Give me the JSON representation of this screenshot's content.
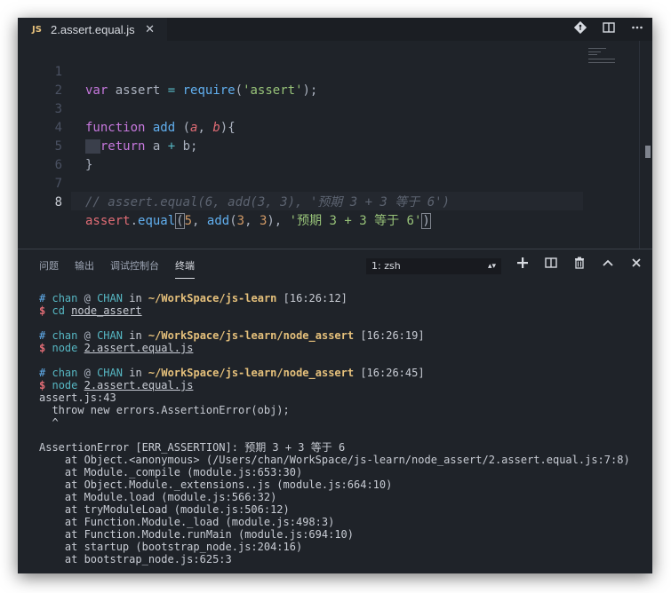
{
  "tab": {
    "icon": "JS",
    "filename": "2.assert.equal.js",
    "close": "✕"
  },
  "editor_actions": [
    "git-compare-icon",
    "split-editor-icon",
    "more-icon"
  ],
  "code_lines": [
    {
      "num": "1",
      "text": "var assert = require('assert');"
    },
    {
      "num": "2",
      "text": ""
    },
    {
      "num": "3",
      "text": "function add (a, b){"
    },
    {
      "num": "4",
      "text": "  return a + b;"
    },
    {
      "num": "5",
      "text": "}"
    },
    {
      "num": "6",
      "text": ""
    },
    {
      "num": "7",
      "text": "// assert.equal(6, add(3, 3), '预期 3 + 3 等于 6')"
    },
    {
      "num": "8",
      "text": "assert.equal(5, add(3, 3), '预期 3 + 3 等于 6')"
    }
  ],
  "panel": {
    "tabs": [
      "问题",
      "输出",
      "调试控制台",
      "终端"
    ],
    "active_tab": "终端",
    "shell": "1: zsh",
    "actions": [
      "add-icon",
      "split-icon",
      "trash-icon",
      "chevron-up-icon",
      "close-icon"
    ]
  },
  "terminal": {
    "prompts": [
      {
        "user": "chan",
        "host": "CHAN",
        "path": "~/WorkSpace/js-learn",
        "time": "[16:26:12]",
        "cmd": "cd",
        "arg": "node_assert"
      },
      {
        "user": "chan",
        "host": "CHAN",
        "path": "~/WorkSpace/js-learn/node_assert",
        "time": "[16:26:19]",
        "cmd": "node",
        "arg": "2.assert.equal.js"
      },
      {
        "user": "chan",
        "host": "CHAN",
        "path": "~/WorkSpace/js-learn/node_assert",
        "time": "[16:26:45]",
        "cmd": "node",
        "arg": "2.assert.equal.js"
      }
    ],
    "output": [
      "assert.js:43",
      "  throw new errors.AssertionError(obj);",
      "  ^",
      "",
      "AssertionError [ERR_ASSERTION]: 预期 3 + 3 等于 6",
      "    at Object.<anonymous> (/Users/chan/WorkSpace/js-learn/node_assert/2.assert.equal.js:7:8)",
      "    at Module._compile (module.js:653:30)",
      "    at Object.Module._extensions..js (module.js:664:10)",
      "    at Module.load (module.js:566:32)",
      "    at tryModuleLoad (module.js:506:12)",
      "    at Function.Module._load (module.js:498:3)",
      "    at Function.Module.runMain (module.js:694:10)",
      "    at startup (bootstrap_node.js:204:16)",
      "    at bootstrap_node.js:625:3"
    ]
  },
  "colors": {
    "background": "#1f2329",
    "keyword": "#c678dd",
    "function": "#61afef",
    "string": "#98c379",
    "number": "#d19a66"
  }
}
